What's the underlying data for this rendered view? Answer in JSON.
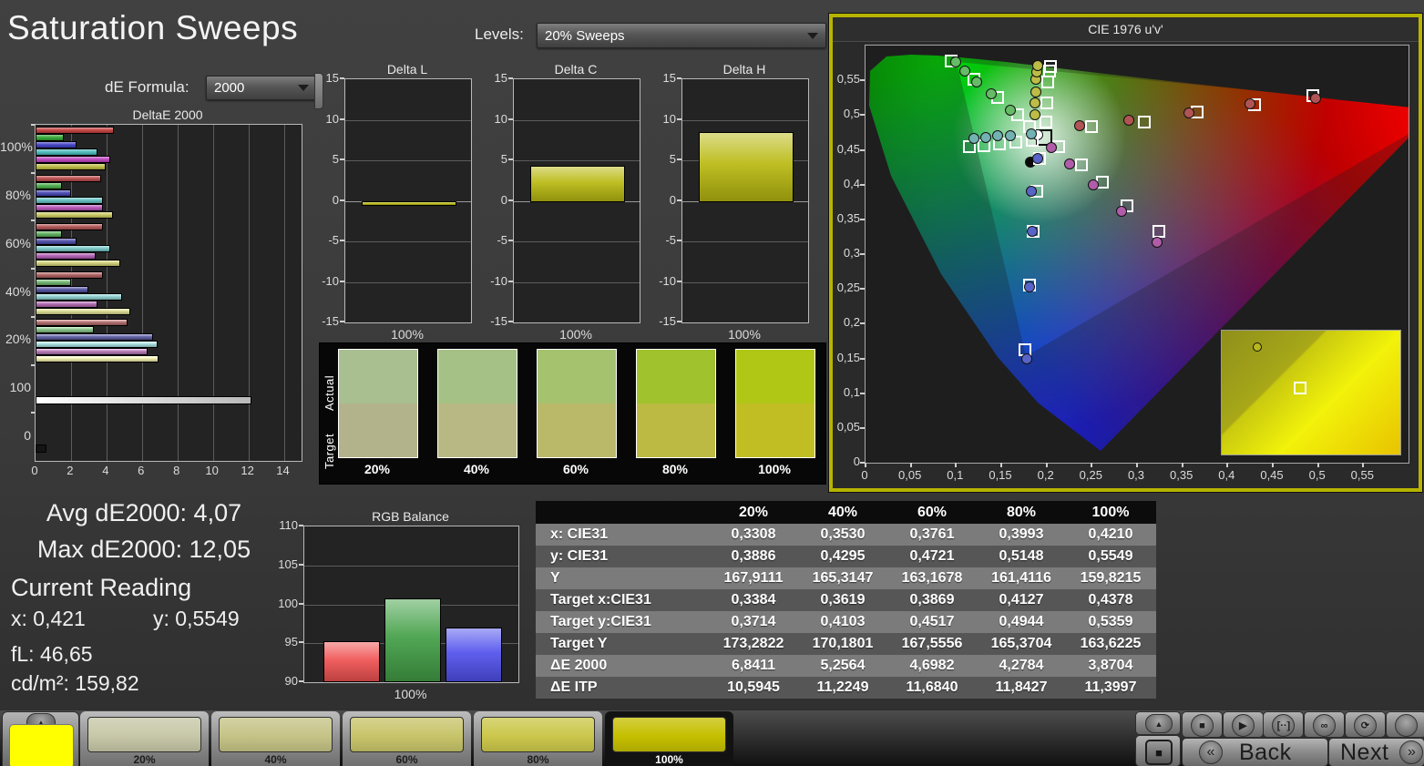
{
  "app": {
    "title": "Saturation Sweeps"
  },
  "controls": {
    "de_formula_label": "dE Formula:",
    "de_formula_value": "2000",
    "levels_label": "Levels:",
    "levels_value": "20% Sweeps"
  },
  "stats": {
    "avg_label": "Avg dE2000:",
    "avg_value": "4,07",
    "max_label": "Max dE2000:",
    "max_value": "12,05",
    "current_heading": "Current Reading",
    "x_label": "x:",
    "x_value": "0,421",
    "y_label": "y:",
    "y_value": "0,5549",
    "fl_label": "fL:",
    "fl_value": "46,65",
    "cd_label": "cd/m²:",
    "cd_value": "159,82"
  },
  "swatch_panel": {
    "row_labels": [
      "Actual",
      "Target"
    ],
    "items": [
      {
        "label": "20%",
        "actual": "#a9bf90",
        "target": "#b3b38b"
      },
      {
        "label": "40%",
        "actual": "#a6c185",
        "target": "#b8b884"
      },
      {
        "label": "60%",
        "actual": "#a5c36e",
        "target": "#bab96a"
      },
      {
        "label": "80%",
        "actual": "#a0c22c",
        "target": "#bcba42"
      },
      {
        "label": "100%",
        "actual": "#b0c716",
        "target": "#c1be24"
      }
    ]
  },
  "results_table": {
    "columns": [
      "20%",
      "40%",
      "60%",
      "80%",
      "100%"
    ],
    "rows": [
      {
        "label": "x: CIE31",
        "values": [
          "0,3308",
          "0,3530",
          "0,3761",
          "0,3993",
          "0,4210"
        ]
      },
      {
        "label": "y: CIE31",
        "values": [
          "0,3886",
          "0,4295",
          "0,4721",
          "0,5148",
          "0,5549"
        ]
      },
      {
        "label": "Y",
        "values": [
          "167,9111",
          "165,3147",
          "163,1678",
          "161,4116",
          "159,8215"
        ]
      },
      {
        "label": "Target x:CIE31",
        "values": [
          "0,3384",
          "0,3619",
          "0,3869",
          "0,4127",
          "0,4378"
        ]
      },
      {
        "label": "Target y:CIE31",
        "values": [
          "0,3714",
          "0,4103",
          "0,4517",
          "0,4944",
          "0,5359"
        ]
      },
      {
        "label": "Target Y",
        "values": [
          "173,2822",
          "170,1801",
          "167,5556",
          "165,3704",
          "163,6225"
        ]
      },
      {
        "label": "ΔE 2000",
        "values": [
          "6,8411",
          "5,2564",
          "4,6982",
          "4,2784",
          "3,8704"
        ]
      },
      {
        "label": "ΔE ITP",
        "values": [
          "10,5945",
          "11,2249",
          "11,6840",
          "11,8427",
          "11,3997"
        ]
      }
    ]
  },
  "bottom_bar": {
    "current_swatch_color": "#ffff00",
    "up_arrow_glyph": "▲",
    "patches": [
      {
        "label": "20%",
        "color": "#c7c7a8",
        "selected": false
      },
      {
        "label": "40%",
        "color": "#c5c386",
        "selected": false
      },
      {
        "label": "60%",
        "color": "#c7c46a",
        "selected": false
      },
      {
        "label": "80%",
        "color": "#cbc74b",
        "selected": false
      },
      {
        "label": "100%",
        "color": "#c5bf00",
        "selected": true
      }
    ],
    "transport_buttons": [
      {
        "name": "stop-button",
        "glyph": "■"
      },
      {
        "name": "play-button",
        "glyph": "▶"
      },
      {
        "name": "series-button",
        "glyph": "[··]"
      },
      {
        "name": "continuous-button",
        "glyph": "∞"
      },
      {
        "name": "loop-button",
        "glyph": "⟳"
      },
      {
        "name": "blank-button",
        "glyph": ""
      }
    ],
    "patch_window_glyph": "■",
    "back_label": "Back",
    "next_label": "Next",
    "back_glyph": "«",
    "next_glyph": "»"
  },
  "chart_data": [
    {
      "id": "deltae2000",
      "type": "bar",
      "orientation": "horizontal",
      "title": "DeltaE 2000",
      "categories": [
        "100%",
        "80%",
        "60%",
        "40%",
        "20%",
        "100",
        "0"
      ],
      "series_names": [
        "Red",
        "Green",
        "Blue",
        "Cyan",
        "Magenta",
        "Yellow"
      ],
      "series_colors": [
        "#c43c3c",
        "#2fa62f",
        "#3c3cc4",
        "#46b8b8",
        "#bc42bc",
        "#bcbc3c"
      ],
      "groups": [
        [
          4.3,
          1.5,
          2.2,
          3.4,
          4.1,
          3.87
        ],
        [
          3.6,
          1.4,
          1.9,
          3.7,
          3.7,
          4.28
        ],
        [
          3.7,
          1.4,
          2.2,
          4.1,
          3.3,
          4.7
        ],
        [
          3.7,
          1.9,
          2.9,
          4.8,
          3.4,
          5.26
        ],
        [
          5.1,
          3.2,
          6.5,
          6.8,
          6.2,
          6.84
        ]
      ],
      "white_bar_value": 12.05,
      "black_bar_value": 0.5,
      "xlim": [
        0,
        15
      ],
      "x_ticks": [
        "0",
        "2",
        "4",
        "6",
        "8",
        "10",
        "12",
        "14"
      ]
    },
    {
      "id": "delta_l",
      "type": "bar",
      "title": "Delta L",
      "categories": [
        "100%"
      ],
      "values": [
        -0.4
      ],
      "ylim": [
        -15,
        15
      ],
      "y_ticks": [
        "15",
        "10",
        "5",
        "0",
        "-5",
        "-10",
        "-15"
      ],
      "bar_color": "#b9b911",
      "xlabel": "100%"
    },
    {
      "id": "delta_c",
      "type": "bar",
      "title": "Delta C",
      "categories": [
        "100%"
      ],
      "values": [
        4.2
      ],
      "ylim": [
        -15,
        15
      ],
      "y_ticks": [
        "15",
        "10",
        "5",
        "0",
        "-5",
        "-10",
        "-15"
      ],
      "bar_color": "#b9b911",
      "xlabel": "100%"
    },
    {
      "id": "delta_h",
      "type": "bar",
      "title": "Delta H",
      "categories": [
        "100%"
      ],
      "values": [
        8.35
      ],
      "ylim": [
        -15,
        15
      ],
      "y_ticks": [
        "15",
        "10",
        "5",
        "0",
        "-5",
        "-10",
        "-15"
      ],
      "bar_color": "#b9b911",
      "xlabel": "100%"
    },
    {
      "id": "rgb_balance",
      "type": "bar",
      "title": "RGB Balance",
      "categories": [
        "Red",
        "Green",
        "Blue"
      ],
      "values": [
        95.0,
        100.5,
        96.8
      ],
      "colors": [
        "#f05252",
        "#43a047",
        "#5252ee"
      ],
      "ylim": [
        90,
        110
      ],
      "y_ticks": [
        "110",
        "105",
        "100",
        "95",
        "90"
      ],
      "xlabel": "100%"
    },
    {
      "id": "cie_1976",
      "type": "scatter",
      "title": "CIE 1976 u'v'",
      "xlim": [
        0,
        0.6
      ],
      "ylim": [
        0,
        0.6
      ],
      "x_ticks": [
        "0",
        "0,05",
        "0,1",
        "0,15",
        "0,2",
        "0,25",
        "0,3",
        "0,35",
        "0,4",
        "0,45",
        "0,5",
        "0,55"
      ],
      "x_tick_values": [
        0,
        0.05,
        0.1,
        0.15,
        0.2,
        0.25,
        0.3,
        0.35,
        0.4,
        0.45,
        0.5,
        0.55
      ],
      "y_ticks": [
        "0,55",
        "0,5",
        "0,45",
        "0,4",
        "0,35",
        "0,3",
        "0,25",
        "0,2",
        "0,15",
        "0,1",
        "0,05",
        "0"
      ],
      "y_tick_values": [
        0.55,
        0.5,
        0.45,
        0.4,
        0.35,
        0.3,
        0.25,
        0.2,
        0.15,
        0.1,
        0.05,
        0
      ],
      "series": [
        {
          "name": "white-target",
          "marker": "square-black",
          "color": "#000000",
          "points": [
            [
              0.197,
              0.468
            ]
          ]
        },
        {
          "name": "white-measured",
          "marker": "circle",
          "color": "#ffffff",
          "points": [
            [
              0.19,
              0.472
            ]
          ]
        },
        {
          "name": "current-reading",
          "marker": "dot",
          "color": "#0a0a0a",
          "points": [
            [
              0.182,
              0.432
            ]
          ]
        },
        {
          "name": "red-target",
          "marker": "square",
          "color": "",
          "points": [
            [
              0.25,
              0.483
            ],
            [
              0.308,
              0.49
            ],
            [
              0.366,
              0.505
            ],
            [
              0.43,
              0.515
            ],
            [
              0.494,
              0.528
            ]
          ]
        },
        {
          "name": "red-measured",
          "marker": "circle",
          "color": "#b05454",
          "points": [
            [
              0.237,
              0.485
            ],
            [
              0.291,
              0.493
            ],
            [
              0.357,
              0.503
            ],
            [
              0.425,
              0.516
            ],
            [
              0.497,
              0.524
            ]
          ]
        },
        {
          "name": "green-target",
          "marker": "square",
          "color": "",
          "points": [
            [
              0.181,
              0.483
            ],
            [
              0.168,
              0.5
            ],
            [
              0.146,
              0.525
            ],
            [
              0.12,
              0.551
            ],
            [
              0.095,
              0.578
            ]
          ]
        },
        {
          "name": "green-measured",
          "marker": "circle",
          "color": "#66bb66",
          "points": [
            [
              0.16,
              0.507
            ],
            [
              0.139,
              0.53
            ],
            [
              0.123,
              0.548
            ],
            [
              0.11,
              0.563
            ],
            [
              0.1,
              0.576
            ]
          ]
        },
        {
          "name": "blue-target",
          "marker": "square",
          "color": "",
          "points": [
            [
              0.192,
              0.437
            ],
            [
              0.189,
              0.39
            ],
            [
              0.185,
              0.333
            ],
            [
              0.181,
              0.255
            ],
            [
              0.176,
              0.162
            ]
          ]
        },
        {
          "name": "blue-measured",
          "marker": "circle",
          "color": "#5864c8",
          "points": [
            [
              0.19,
              0.437
            ],
            [
              0.183,
              0.39
            ],
            [
              0.184,
              0.333
            ],
            [
              0.181,
              0.253
            ],
            [
              0.178,
              0.15
            ]
          ]
        },
        {
          "name": "cyan-target",
          "marker": "square",
          "color": "",
          "points": [
            [
              0.115,
              0.455
            ],
            [
              0.131,
              0.456
            ],
            [
              0.148,
              0.458
            ],
            [
              0.166,
              0.461
            ],
            [
              0.184,
              0.464
            ]
          ]
        },
        {
          "name": "cyan-measured",
          "marker": "circle",
          "color": "#72b2b2",
          "points": [
            [
              0.12,
              0.466
            ],
            [
              0.133,
              0.468
            ],
            [
              0.146,
              0.47
            ],
            [
              0.16,
              0.47
            ],
            [
              0.183,
              0.473
            ]
          ]
        },
        {
          "name": "magenta-target",
          "marker": "square",
          "color": "",
          "points": [
            [
              0.213,
              0.455
            ],
            [
              0.239,
              0.428
            ],
            [
              0.262,
              0.403
            ],
            [
              0.289,
              0.37
            ],
            [
              0.324,
              0.333
            ]
          ]
        },
        {
          "name": "magenta-measured",
          "marker": "circle",
          "color": "#b05ca8",
          "points": [
            [
              0.205,
              0.453
            ],
            [
              0.226,
              0.43
            ],
            [
              0.252,
              0.4
            ],
            [
              0.283,
              0.362
            ],
            [
              0.322,
              0.317
            ]
          ]
        },
        {
          "name": "yellow-target",
          "marker": "square",
          "color": "",
          "points": [
            [
              0.199,
              0.49
            ],
            [
              0.2,
              0.517
            ],
            [
              0.201,
              0.547
            ],
            [
              0.203,
              0.563
            ],
            [
              0.204,
              0.57
            ]
          ]
        },
        {
          "name": "yellow-measured",
          "marker": "circle",
          "color": "#bcbc46",
          "points": [
            [
              0.187,
              0.5
            ],
            [
              0.187,
              0.518
            ],
            [
              0.188,
              0.533
            ],
            [
              0.188,
              0.551
            ],
            [
              0.189,
              0.562
            ],
            [
              0.19,
              0.571
            ]
          ]
        }
      ],
      "inset": {
        "points": [
          {
            "type": "circle",
            "color": "#b8b81e",
            "fx": 0.2,
            "fy": 0.13
          },
          {
            "type": "square",
            "color": "",
            "fx": 0.44,
            "fy": 0.46
          }
        ]
      }
    }
  ]
}
